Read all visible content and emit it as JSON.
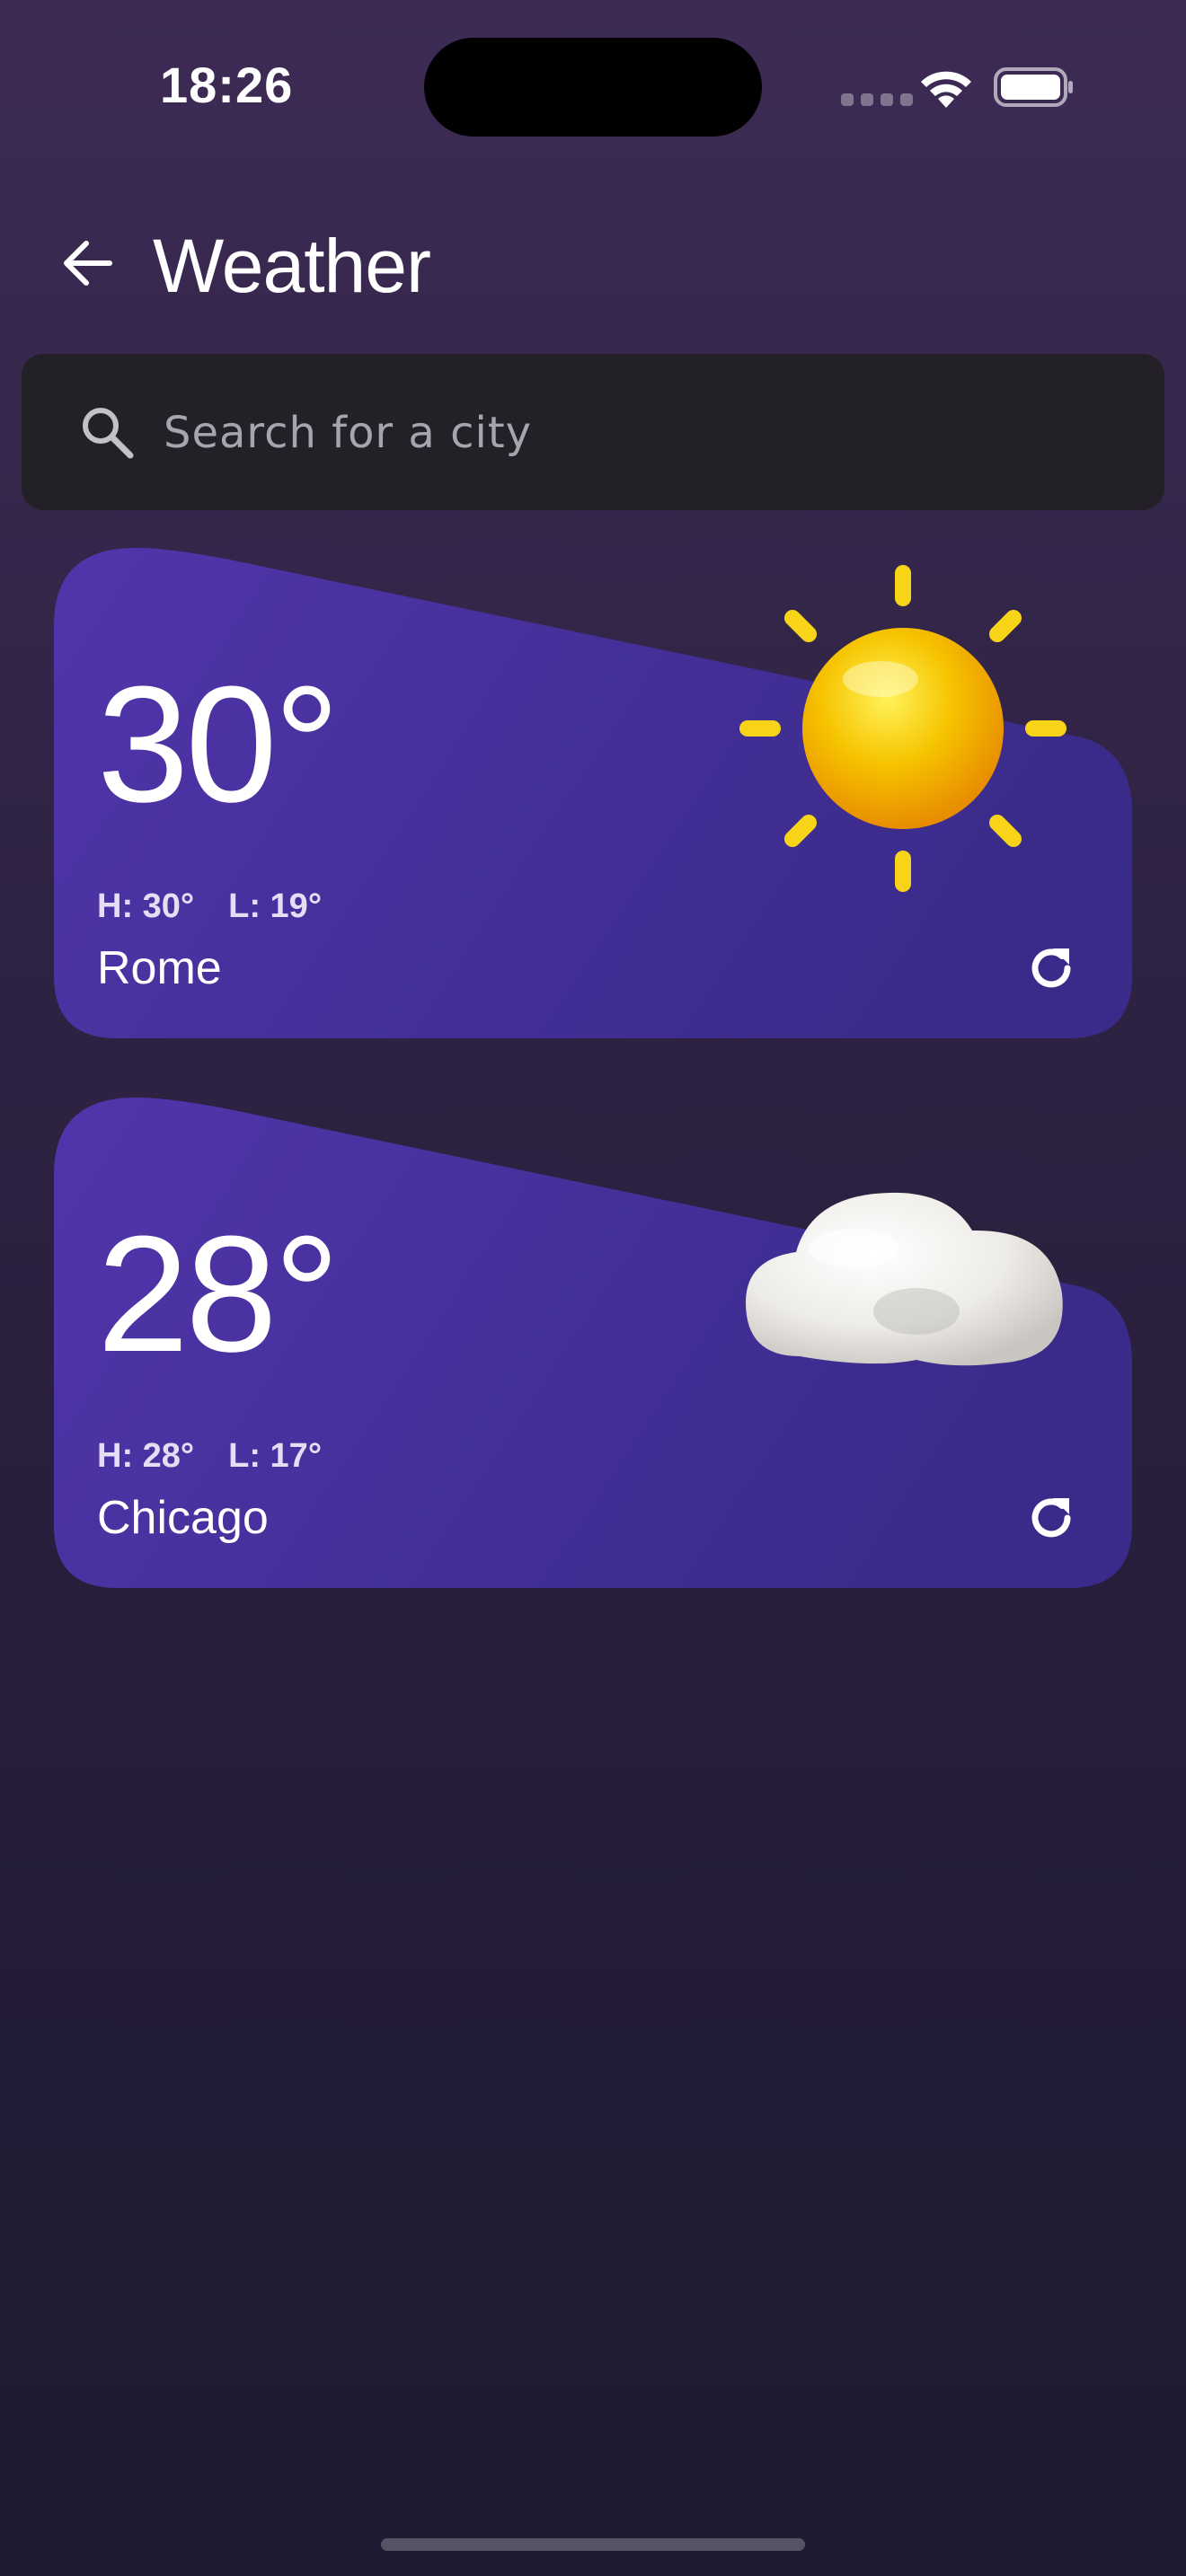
{
  "status_bar": {
    "time": "18:26"
  },
  "header": {
    "title": "Weather"
  },
  "search": {
    "placeholder": "Search for a city",
    "value": ""
  },
  "cards": [
    {
      "temperature": "30°",
      "high": "H: 30°",
      "low": "L: 19°",
      "city": "Rome",
      "condition_icon": "sun-icon"
    },
    {
      "temperature": "28°",
      "high": "H: 28°",
      "low": "L: 17°",
      "city": "Chicago",
      "condition_icon": "cloud-icon"
    }
  ],
  "colors": {
    "card_gradient_start": "#5135ab",
    "card_gradient_end": "#3a2b8a",
    "search_background": "#232127",
    "sun": "#f6c400"
  }
}
